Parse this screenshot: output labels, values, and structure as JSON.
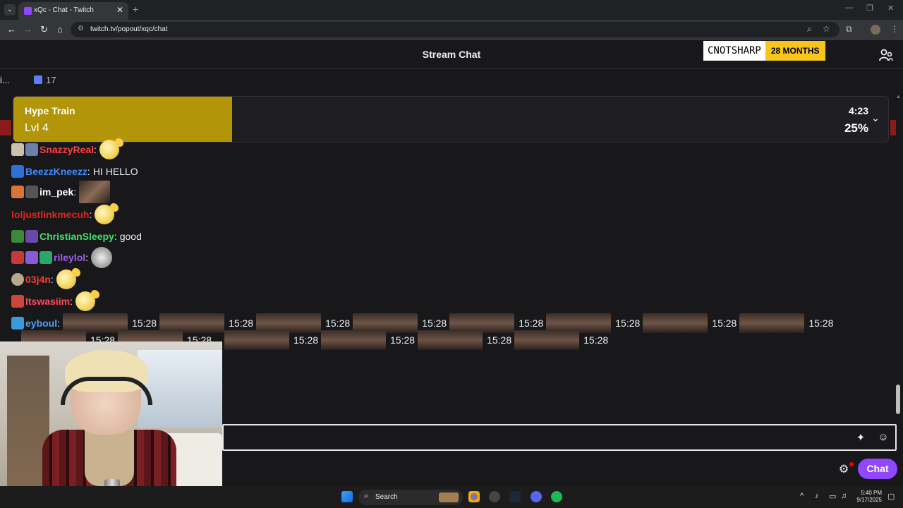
{
  "browser": {
    "tab_title": "xQc - Chat - Twitch",
    "tab_close": "✕",
    "new_tab": "+",
    "url": "twitch.tv/popout/xqc/chat"
  },
  "header": {
    "title": "Stream Chat",
    "sub_name": "CNOTSHARP",
    "sub_months": "28 MONTHS"
  },
  "gift_row": {
    "left_text": "i...",
    "gift_count": "17"
  },
  "hype_train": {
    "label": "Hype Train",
    "level": "Lvl 4",
    "time": "4:23",
    "percent_label": "25%",
    "progress": 0.25
  },
  "messages": [
    {
      "user": "SnazzyReal",
      "color": "#ff4040",
      "text": ""
    },
    {
      "user": "BeezzKneezz",
      "color": "#3f8cff",
      "text": "HI HELLO"
    },
    {
      "user": "im_pek",
      "color": "#ffffff",
      "text": ""
    },
    {
      "user": "loljustlinkmecuh",
      "color": "#e0241c",
      "text": ""
    },
    {
      "user": "ChristianSleepy",
      "color": "#3fe06a",
      "text": "good"
    },
    {
      "user": "rileylol",
      "color": "#9b5cf0",
      "text": ""
    },
    {
      "user": "03j4n",
      "color": "#ff3b2f",
      "text": ""
    },
    {
      "user": "Itswasiim",
      "color": "#ff4a5a",
      "text": ""
    },
    {
      "user": "eyboul",
      "color": "#4aa3ff",
      "text": ""
    }
  ],
  "spam_timestamp": "15:28",
  "chat_button": "Chat",
  "taskbar": {
    "search": "Search",
    "time": "5:40 PM",
    "date": "9/17/2025"
  },
  "colors": {
    "accent": "#9147ff",
    "hype": "#b3950a",
    "sub_gold": "#f7c51b"
  }
}
